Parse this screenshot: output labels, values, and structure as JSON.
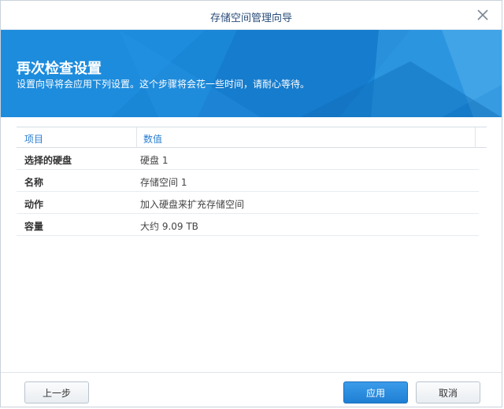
{
  "window": {
    "title": "存储空间管理向导"
  },
  "banner": {
    "title": "再次检查设置",
    "subtitle": "设置向导将会应用下列设置。这个步骤将会花一些时间，请耐心等待。"
  },
  "table": {
    "headers": [
      "项目",
      "数值"
    ],
    "rows": [
      {
        "key": "选择的硬盘",
        "value": "硬盘 1"
      },
      {
        "key": "名称",
        "value": "存储空间 1"
      },
      {
        "key": "动作",
        "value": "加入硬盘来扩充存储空间"
      },
      {
        "key": "容量",
        "value": "大约 9.09 TB"
      }
    ]
  },
  "footer": {
    "back_label": "上一步",
    "apply_label": "应用",
    "cancel_label": "取消"
  },
  "colors": {
    "accent": "#1f7fd3",
    "banner": "#1a86d6",
    "header_text": "#2a7ed2"
  },
  "icons": {
    "close": "close-icon"
  }
}
